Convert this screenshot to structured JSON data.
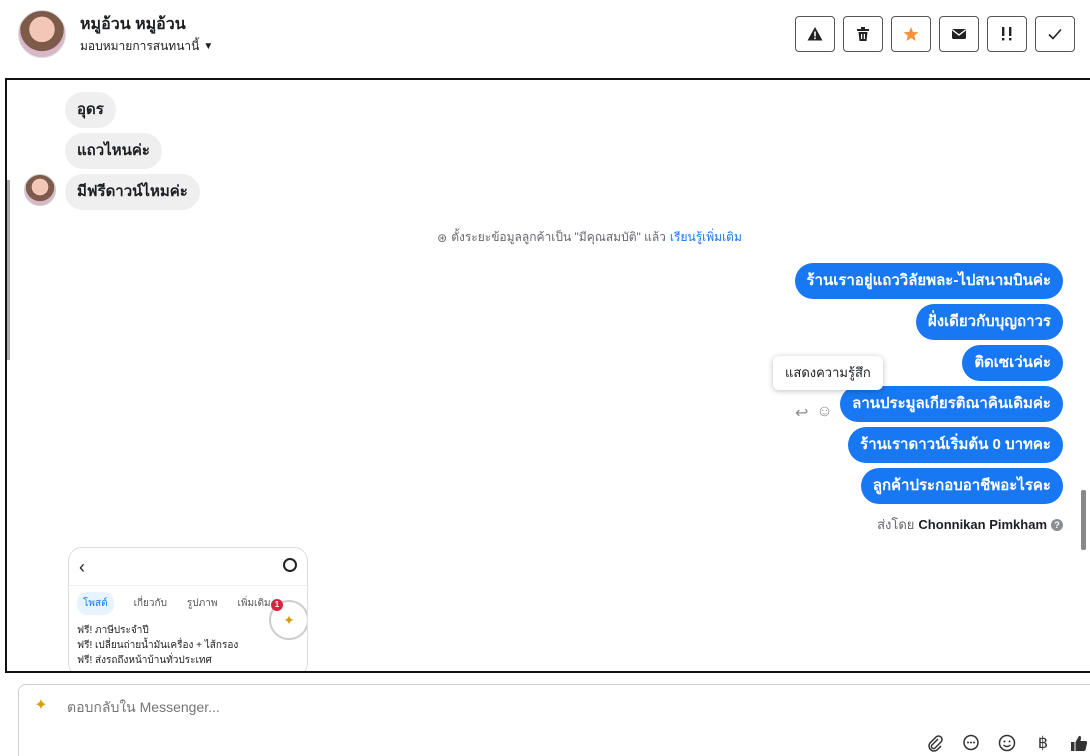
{
  "header": {
    "name": "หมูอ้วน หมูอ้วน",
    "assign_label": "มอบหมายการสนทนานี้",
    "caret_icon": "▼"
  },
  "toolbar": [
    {
      "name": "spam-button",
      "icon": "warning-icon"
    },
    {
      "name": "delete-button",
      "icon": "trash-icon"
    },
    {
      "name": "star-button",
      "icon": "star-icon",
      "color": "#f7923a"
    },
    {
      "name": "mark-unread-button",
      "icon": "envelope-icon"
    },
    {
      "name": "follow-up-button",
      "icon": "exclamation-icon"
    },
    {
      "name": "mark-done-button",
      "icon": "check-icon"
    }
  ],
  "incoming": [
    "อุดร",
    "แถวไหนค่ะ",
    "มีฟรีดาวน์ไหมค่ะ"
  ],
  "system_note": {
    "icon": "⊛",
    "text": "ตั้งระยะข้อมูลลูกค้าเป็น \"มีคุณสมบัติ\" แล้ว",
    "link": "เรียนรู้เพิ่มเติม"
  },
  "outgoing": [
    "ร้านเราอยู่แถววิลัยพละ-ไปสนามบินค่ะ",
    "ฝั่งเดียวกับบุญถาวร",
    "ติดเซเว่นค่ะ",
    "ลานประมูลเกียรติณาคินเดิมค่ะ",
    "ร้านเราดาวน์เริ่มต้น 0 บาทคะ",
    "ลูกค้าประกอบอาชีพอะไรคะ"
  ],
  "tooltip": "แสดงความรู้สึก",
  "hover_actions": {
    "reply": "↩",
    "react": "☺"
  },
  "sent_by": {
    "prefix": "ส่งโดย",
    "name": "Chonnikan Pimkham",
    "help": "?"
  },
  "card": {
    "back": "‹",
    "tabs": [
      "โพสต์",
      "เกี่ยวกับ",
      "รูปภาพ",
      "เพิ่มเติม"
    ],
    "badge": "1",
    "lines": [
      "ฟรี! ภาษีประจำปี",
      "ฟรี! เปลี่ยนถ่ายน้ำมันเครื่อง + ไส้กรอง",
      "ฟรี! ส่งรถถึงหน้าบ้านทั่วประเทศ"
    ]
  },
  "composer": {
    "placeholder": "ตอบกลับใน Messenger...",
    "icons": [
      "paperclip-icon",
      "chat-icon",
      "emoji-icon",
      "baht-icon",
      "thumbs-up-icon"
    ]
  },
  "colors": {
    "accent": "#1877f2",
    "bubble_in": "#efefef"
  }
}
